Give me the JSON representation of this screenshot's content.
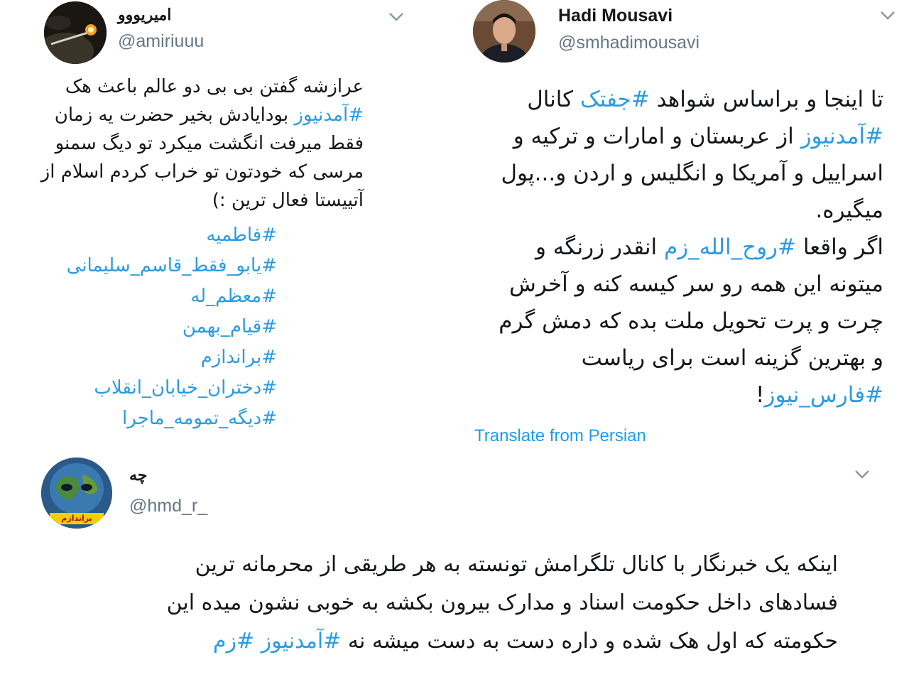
{
  "colors": {
    "hashtag": "#2b9be0",
    "handle": "#657786",
    "text": "#14171a",
    "link": "#1d9bf0"
  },
  "tweet_left": {
    "name": "امیریووو",
    "handle": "@amiriuuu",
    "lines": [
      "عرازشه گفتن بی بی دو عالم باعث هک",
      "بودایادش بخیر حضرت یه زمان",
      "فقط میرفت انگشت میکرد تو دیگ سمنو",
      "مرسی که خودتون تو خراب کردم اسلام از",
      "آتییستا فعال ترین :)"
    ],
    "inline_hashtag": "#آمدنیوز",
    "hashtags": [
      "#فاطمیه",
      "#یابو_فقط_قاسم_سلیمانی",
      "#معظم_له",
      "#قیام_بهمن",
      "#براندازم",
      "#دختران_خیابان_انقلاب",
      "#دیگه_تمومه_ماجرا"
    ]
  },
  "tweet_right": {
    "name": "Hadi Mousavi",
    "handle": "@smhadimousavi",
    "l1_pre": "تا اینجا و براساس شواهد",
    "l1_tag": "#جفتک",
    "l1_post": "کانال",
    "l2_tag": "#آمدنیوز",
    "l2_post": "از عربستان و امارات و ترکیه و",
    "l3": "اسراییل و آمریکا و انگلیس و اردن و...پول",
    "l4": "میگیره.",
    "l5_pre": "اگر واقعا",
    "l5_tag": "#روح_الله_زم",
    "l5_post": "انقدر زرنگه و",
    "l6": "میتونه این همه رو سر کیسه کنه و آخرش",
    "l7": "چرت و پرت تحویل ملت بده که دمش گرم",
    "l8": "و بهترین گزینه است برای ریاست",
    "l9_tag": "#فارس_نیوز",
    "l9_post": "!",
    "translate": "Translate from Persian"
  },
  "tweet_bottom": {
    "name": "چه",
    "handle": "@hmd_r_",
    "avatar_caption": "براندازم",
    "l1": "اینکه یک خبرنگار با کانال تلگرامش تونسته به هر طریقی از محرمانه ترین",
    "l2": "فسادهای داخل حکومت اسناد و مدارک بیرون بکشه به خوبی نشون میده این",
    "l3_text": "حکومته که اول هک شده و داره دست به دست میشه نه",
    "l3_tag1": "#آمدنیوز",
    "l3_tag2": "#زم"
  }
}
